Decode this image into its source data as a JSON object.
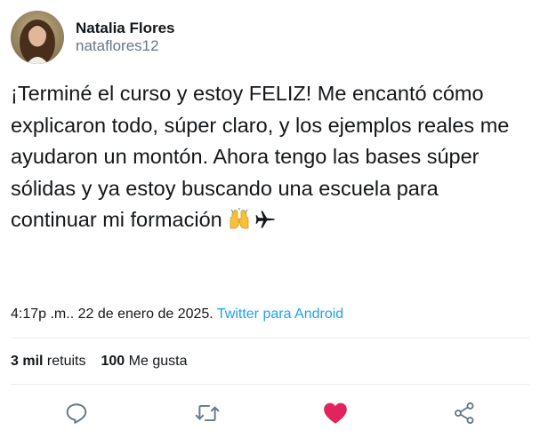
{
  "user": {
    "display_name": "Natalia Flores",
    "handle": "nataflores12"
  },
  "tweet": {
    "text": "¡Terminé el curso y estoy FELIZ! Me encantó cómo explicaron todo, súper claro, y los ejemplos reales me ayudaron un montón. Ahora tengo las bases súper sólidas y ya estoy buscando una escuela para continuar mi formación",
    "emojis": [
      "raising-hands-icon",
      "airplane-icon"
    ]
  },
  "meta": {
    "time": "4:17p  .m.. 22 de enero de 2025.",
    "source": "Twitter para Android"
  },
  "stats": {
    "retweets_count": "3 mil",
    "retweets_label": "retuits",
    "likes_count": "100",
    "likes_label": "Me gusta"
  },
  "actions": [
    "reply-icon",
    "retweet-icon",
    "like-icon",
    "share-icon"
  ],
  "colors": {
    "link": "#1da1f2",
    "like": "#e0245e",
    "muted": "#657786",
    "icon": "#657786"
  }
}
